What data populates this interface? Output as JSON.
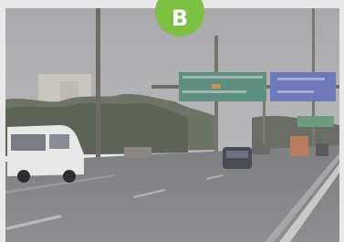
{
  "badge": {
    "label": "B",
    "color": "#7cc142"
  },
  "photo": {
    "subject": "highway-road-scene",
    "sign_colors": {
      "green_sign": "#5f8f80",
      "blue_sign": "#6c78b8"
    }
  }
}
